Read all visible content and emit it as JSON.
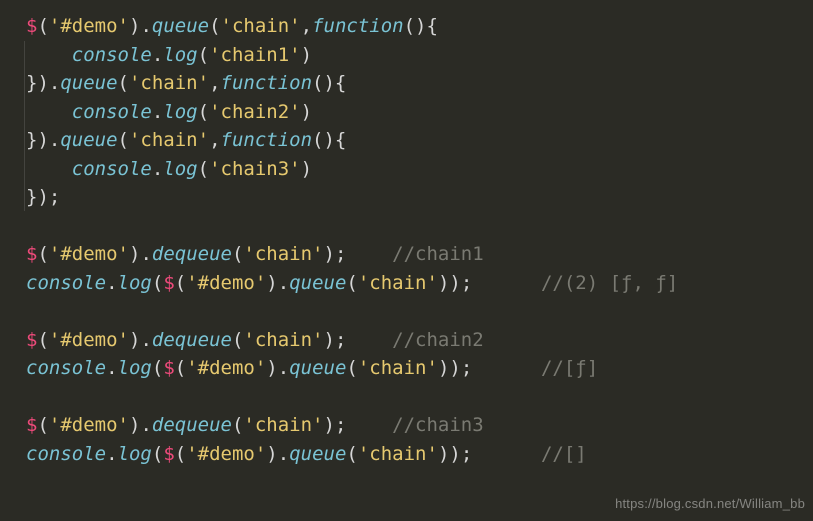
{
  "fn": {
    "dollar": "$",
    "queue": "queue",
    "dequeue": "dequeue",
    "log": "log",
    "function": "function"
  },
  "obj": {
    "console": "console"
  },
  "str": {
    "demo": "'#demo'",
    "chain": "'chain'",
    "c1": "'chain1'",
    "c2": "'chain2'",
    "c3": "'chain3'"
  },
  "punc": {
    "op": "(",
    "cp": ")",
    "ob": "{",
    "cb": "}",
    "dot": ".",
    "sc": ";",
    "comma": ",",
    "call": "(){",
    "closeChain": "}).",
    "end": "});"
  },
  "cmt": {
    "c1": "//chain1",
    "c2": "//chain2",
    "c3": "//chain3",
    "r1": "//(2) [ƒ, ƒ]",
    "r2": "//[ƒ]",
    "r3": "//[]"
  },
  "sp": {
    "in": "    ",
    "g1": "    ",
    "g2": "      "
  },
  "watermark": "https://blog.csdn.net/William_bb"
}
